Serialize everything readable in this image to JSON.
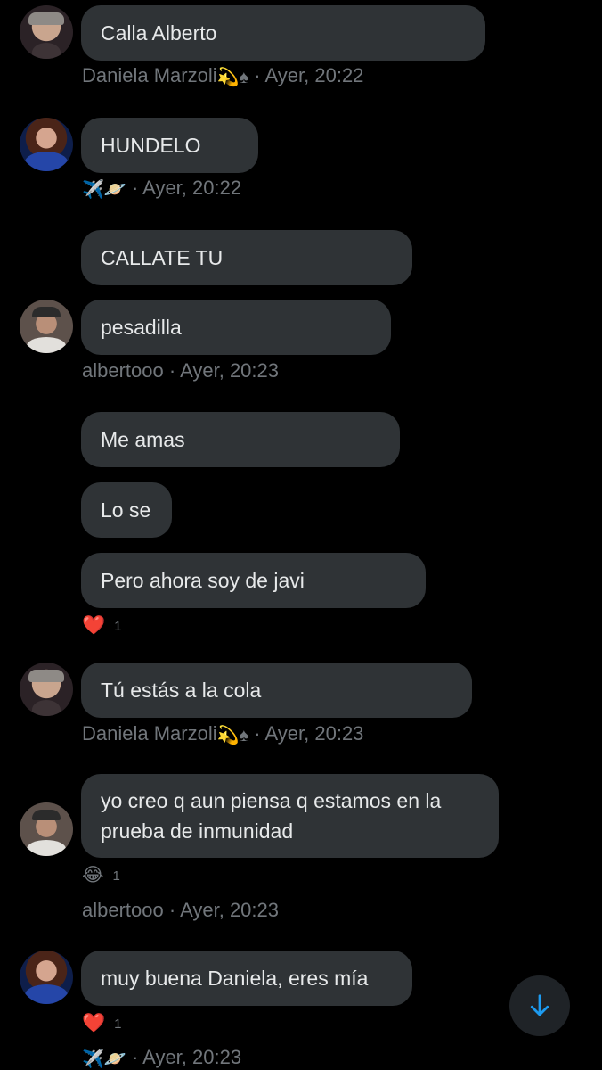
{
  "messages": [
    {
      "text": "Calla Alberto"
    },
    {
      "text": "HUNDELO"
    },
    {
      "text": "CALLATE TU"
    },
    {
      "text": "pesadilla"
    },
    {
      "text": "Me amas"
    },
    {
      "text": "Lo se"
    },
    {
      "text": "Pero ahora soy de javi",
      "reaction": {
        "emoji": "❤️",
        "count": "1"
      }
    },
    {
      "text": "Tú estás a la cola"
    },
    {
      "text": "yo creo q aun piensa q estamos en la prueba de inmunidad",
      "reaction": {
        "emoji": "😂",
        "count": "1"
      }
    },
    {
      "text": "muy buena Daniela, eres mía",
      "reaction": {
        "emoji": "❤️",
        "count": "1"
      }
    }
  ],
  "meta": [
    {
      "name": "Daniela Marzoli",
      "glyphs": "💫♠",
      "time": "· Ayer, 20:22"
    },
    {
      "name": "",
      "glyphs": "✈️🪐",
      "time": "· Ayer, 20:22"
    },
    {
      "name": "albertooo",
      "glyphs": "",
      "time": "· Ayer, 20:23"
    },
    {
      "name": "Daniela Marzoli",
      "glyphs": "💫♠",
      "time": "· Ayer, 20:23"
    },
    {
      "name": "albertooo",
      "glyphs": "",
      "time": "· Ayer, 20:23"
    },
    {
      "name": "",
      "glyphs": "✈️🪐",
      "time": "· Ayer, 20:23"
    }
  ],
  "icons": {
    "scroll_down": "arrow-down-icon"
  },
  "colors": {
    "background": "#000000",
    "bubble": "#2f3336",
    "meta_text": "#71767b",
    "accent": "#1d9bf0"
  }
}
